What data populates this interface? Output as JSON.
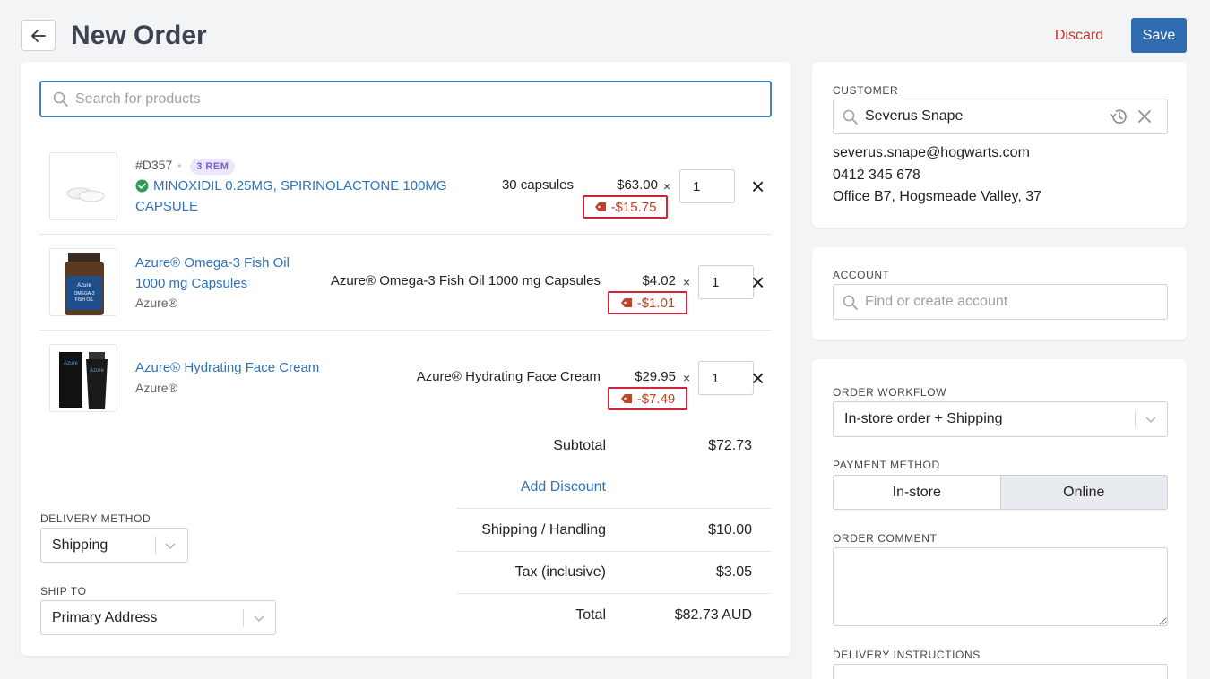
{
  "header": {
    "title": "New Order",
    "discard_label": "Discard",
    "save_label": "Save"
  },
  "search": {
    "placeholder": "Search for products"
  },
  "products": [
    {
      "sku": "#D357",
      "badge": "3 REM",
      "name": "MINOXIDIL 0.25MG, SPIRINOLACTONE 100MG CAPSULE",
      "name_line1": "MINOXIDIL 0.25MG, SPIRINOLACTONE 100MG",
      "name_line2": "CAPSULE",
      "verified": true,
      "variant": "30 capsules",
      "price": "$63.00",
      "times": "×",
      "qty": "1",
      "discount": "-$15.75"
    },
    {
      "name": "Azure® Omega-3 Fish Oil 1000 mg Capsules",
      "name_line1": "Azure® Omega-3 Fish Oil",
      "name_line2": "1000 mg Capsules",
      "brand": "Azure®",
      "variant": "Azure® Omega-3 Fish Oil 1000 mg Capsules",
      "price": "$4.02",
      "times": "×",
      "qty": "1",
      "discount": "-$1.01"
    },
    {
      "name": "Azure® Hydrating Face Cream",
      "brand": "Azure®",
      "variant": "Azure® Hydrating Face Cream",
      "price": "$29.95",
      "times": "×",
      "qty": "1",
      "discount": "-$7.49"
    }
  ],
  "summary": {
    "subtotal_label": "Subtotal",
    "subtotal": "$72.73",
    "add_discount": "Add Discount",
    "shipping_label": "Shipping / Handling",
    "shipping": "$10.00",
    "tax_label": "Tax (inclusive)",
    "tax": "$3.05",
    "total_label": "Total",
    "total": "$82.73 AUD"
  },
  "delivery": {
    "method_label": "DELIVERY METHOD",
    "method": "Shipping",
    "ship_to_label": "SHIP TO",
    "ship_to": "Primary Address"
  },
  "customer": {
    "label": "CUSTOMER",
    "name": "Severus Snape",
    "email": "severus.snape@hogwarts.com",
    "phone": "0412 345 678",
    "address": "Office B7, Hogsmeade Valley, 37"
  },
  "account": {
    "label": "ACCOUNT",
    "placeholder": "Find or create account"
  },
  "order": {
    "workflow_label": "ORDER WORKFLOW",
    "workflow": "In-store order + Shipping",
    "payment_label": "PAYMENT METHOD",
    "payment_options": [
      "In-store",
      "Online"
    ],
    "payment_selected": "Online",
    "comment_label": "ORDER COMMENT",
    "instructions_label": "DELIVERY INSTRUCTIONS"
  },
  "colors": {
    "primary": "#2f6db0",
    "link": "#2f72b8",
    "discard": "#c0392b",
    "discount_border": "#d0243a",
    "verified": "#2e9b5a",
    "badge_bg": "#ece6fb"
  }
}
